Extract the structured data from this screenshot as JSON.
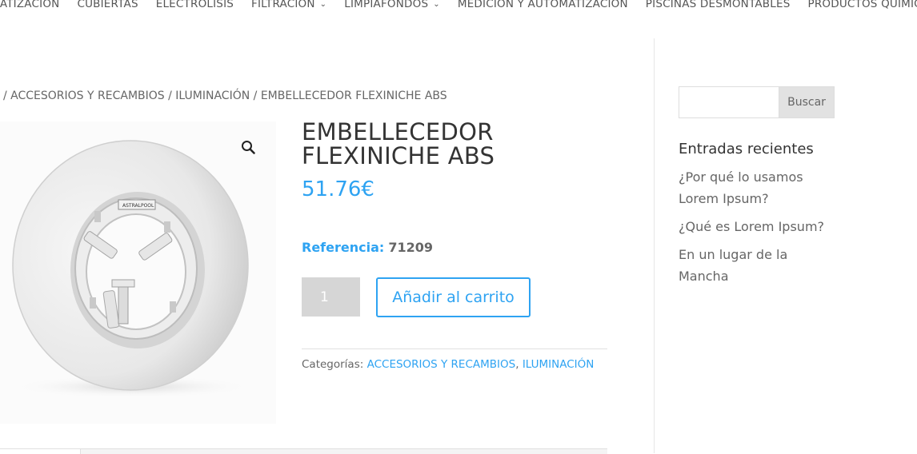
{
  "nav": {
    "items": [
      {
        "label": "MATIZACIÓN",
        "dropdown": false
      },
      {
        "label": "CUBIERTAS",
        "dropdown": false
      },
      {
        "label": "ELECTRÓLISIS",
        "dropdown": false
      },
      {
        "label": "FILTRACIÓN",
        "dropdown": true
      },
      {
        "label": "LIMPIAFONDOS",
        "dropdown": true
      },
      {
        "label": "MEDICIÓN Y AUTOMATIZACIÓN",
        "dropdown": false
      },
      {
        "label": "PISCINAS DESMONTABLES",
        "dropdown": false
      },
      {
        "label": "PRODUCTOS QUÍMICOS",
        "dropdown": false
      }
    ]
  },
  "breadcrumb": {
    "sep": "/",
    "items": [
      "ACCESORIOS Y RECAMBIOS",
      "ILUMINACIÓN",
      "EMBELLECEDOR FLEXINICHE ABS"
    ]
  },
  "product": {
    "title": "EMBELLECEDOR FLEXINICHE ABS",
    "price": "51.76€",
    "reference_label": "Referencia:",
    "reference_value": "71209",
    "quantity": "1",
    "add_to_cart_label": "Añadir al carrito",
    "categories_label": "Categorías:",
    "categories": [
      "ACCESORIOS Y RECAMBIOS",
      "ILUMINACIÓN"
    ],
    "categories_sep": ",",
    "image_brand_text": "ASTRALPOOL",
    "zoom_icon": "magnifier-icon"
  },
  "sidebar": {
    "search_button_label": "Buscar",
    "search_placeholder": "",
    "recent_posts_title": "Entradas recientes",
    "recent_posts": [
      "¿Por qué lo usamos Lorem Ipsum?",
      "¿Qué es Lorem Ipsum?",
      "En un lugar de la Mancha"
    ]
  },
  "colors": {
    "accent": "#2ea3f2",
    "text": "#666666",
    "heading": "#333333"
  }
}
